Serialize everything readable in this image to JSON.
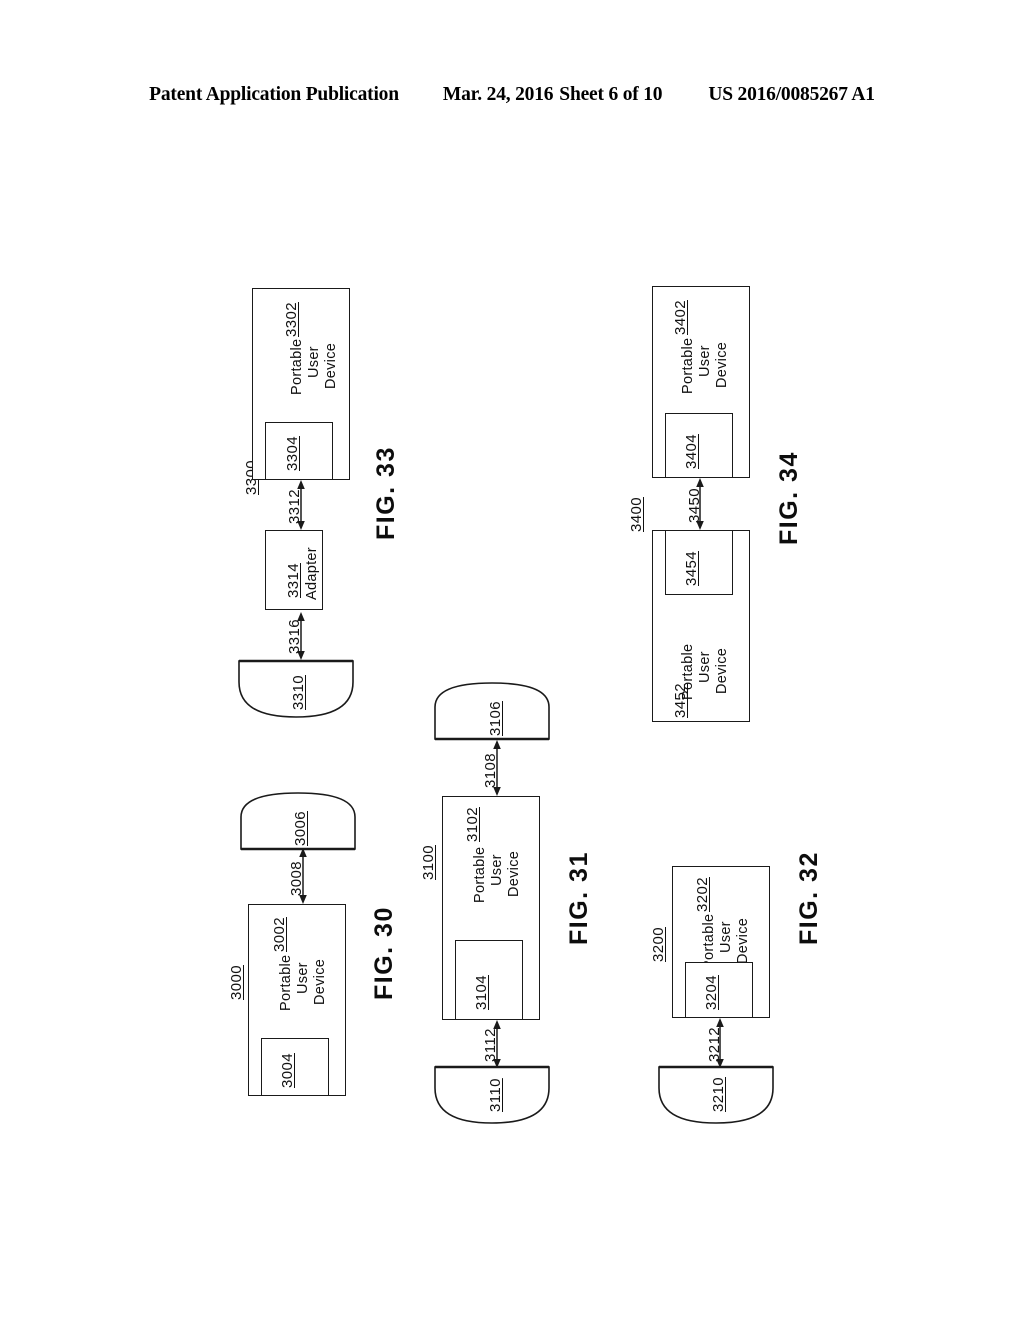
{
  "header": {
    "publication": "Patent Application Publication",
    "date": "Mar. 24, 2016",
    "sheet": "Sheet 6 of 10",
    "patent_number": "US 2016/0085267 A1"
  },
  "device_label": {
    "line1": "Portable",
    "line2": "User",
    "line3": "Device"
  },
  "adapter_label": "Adapter",
  "figures": [
    {
      "id": "fig30",
      "caption": "FIG. 30",
      "system_ref": "3000",
      "elements": {
        "device_ref": "3002",
        "device_port_ref": "3004",
        "bowl_ref": "3006",
        "link_ref": "3008"
      }
    },
    {
      "id": "fig31",
      "caption": "FIG. 31",
      "system_ref": "3100",
      "elements": {
        "device_ref": "3102",
        "device_port_ref": "3104",
        "bowl_top_ref": "3106",
        "link_top_ref": "3108",
        "bowl_bottom_ref": "3110",
        "link_bottom_ref": "3112"
      }
    },
    {
      "id": "fig32",
      "caption": "FIG. 32",
      "system_ref": "3200",
      "elements": {
        "device_ref": "3202",
        "device_port_ref": "3204",
        "bowl_ref": "3210",
        "link_ref": "3212"
      }
    },
    {
      "id": "fig33",
      "caption": "FIG. 33",
      "system_ref": "3300",
      "elements": {
        "device_ref": "3302",
        "device_port_ref": "3304",
        "bowl_ref": "3310",
        "link_device_adapter_ref": "3312",
        "adapter_ref": "3314",
        "link_adapter_bowl_ref": "3316"
      }
    },
    {
      "id": "fig34",
      "caption": "FIG. 34",
      "system_ref": "3400",
      "elements": {
        "device_a_ref": "3402",
        "device_a_port_ref": "3404",
        "link_ref": "3450",
        "device_b_ref": "3452",
        "device_b_port_ref": "3454"
      }
    }
  ]
}
